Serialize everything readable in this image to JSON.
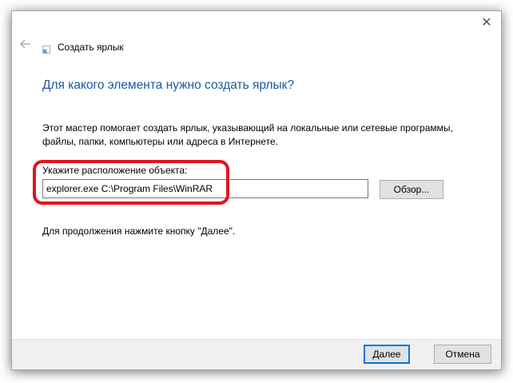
{
  "window": {
    "title": "Создать ярлык",
    "close_glyph": "✕"
  },
  "main": {
    "heading": "Для какого элемента нужно создать ярлык?",
    "description": "Этот мастер помогает создать ярлык, указывающий на локальные или сетевые программы, файлы, папки, компьютеры или адреса в Интернете.",
    "location_label": "Укажите расположение объекта:",
    "location_value": "explorer.exe C:\\Program Files\\WinRAR",
    "browse_label": "Обзор...",
    "hint": "Для продолжения нажмите кнопку \"Далее\"."
  },
  "footer": {
    "next_label": "Далее",
    "cancel_label": "Отмена"
  },
  "colors": {
    "heading": "#1a5aa0",
    "highlight": "#e0141e",
    "default_button_border": "#0078d7"
  },
  "icons": [
    "close-icon",
    "back-arrow-icon",
    "shortcut-icon"
  ]
}
